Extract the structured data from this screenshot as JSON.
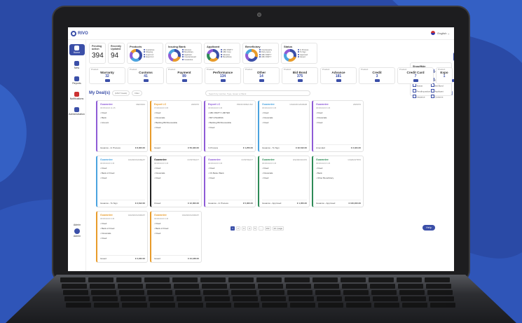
{
  "app": {
    "logo": "RIVO",
    "language": "English"
  },
  "sidebar": {
    "items": [
      {
        "label": "Home",
        "active": true
      },
      {
        "label": "New",
        "active": false
      },
      {
        "label": "Reports",
        "active": false
      },
      {
        "label": "Notifications",
        "active": false
      },
      {
        "label": "Administration",
        "active": false
      }
    ],
    "user_role": "Admin",
    "user_name": "Admin"
  },
  "stats": [
    {
      "label": "Pending action",
      "value": "394"
    },
    {
      "label": "Recently Updated",
      "value": "94"
    }
  ],
  "donuts": [
    {
      "label": "Products",
      "legend": [
        "Guarantee",
        "Shipping",
        "Import LC",
        "Export LC"
      ]
    },
    {
      "label": "Issuing Bank",
      "legend": [
        "Advance",
        "Beneficiary",
        "Applicant",
        "Counterissued",
        "Guarantee"
      ]
    },
    {
      "label": "Applicant",
      "legend": [
        "ABC PARTY",
        "ABC Corp",
        "Advance",
        "Beneficiary"
      ]
    },
    {
      "label": "Beneficiary",
      "legend": [
        "Counterparty",
        "Party name",
        "ABC PARTY",
        "ABC PARTY"
      ]
    },
    {
      "label": "Status",
      "legend": [
        "In Process",
        "To Sign",
        "Approved",
        "Issued"
      ]
    }
  ],
  "show_hide": {
    "title": "Show/Hide",
    "options": [
      "Recently Updated",
      "Products",
      "Issuing Bank",
      "Beneficiary",
      "Status",
      "Bid Bond",
      "Pending action",
      "Applicant",
      "Issuance",
      "Customs"
    ]
  },
  "products": [
    {
      "name": "Warranty",
      "count": "32"
    },
    {
      "name": "Customs",
      "count": "41"
    },
    {
      "name": "Payment",
      "count": "89"
    },
    {
      "name": "Performance",
      "count": "134"
    },
    {
      "name": "Other",
      "count": "14"
    },
    {
      "name": "Bid Bond",
      "count": "375"
    },
    {
      "name": "Advance",
      "count": "181"
    },
    {
      "name": "Credit",
      "count": "3"
    },
    {
      "name": "Credit Card",
      "count": "7"
    },
    {
      "name": "Expo",
      "count": "1"
    }
  ],
  "deals": {
    "title": "My Deal(s)",
    "count_pill": "(1847 Deals)",
    "filter": "Filter",
    "search_placeholder": "Search by number, Type, Issuer or Bank",
    "cards": [
      {
        "type": "Guarantee",
        "ref": "REF0044",
        "date": "06/05/2023 11:45",
        "lines": [
          "Fixed",
          "Bank",
          "Amount"
        ],
        "status": "Issuance - In Process",
        "amount": "€ 8,300.00",
        "color": "#8e5bd6"
      },
      {
        "type": "Export LC",
        "ref": "LB/0070",
        "date": "07/06/2023 6:05",
        "lines": [
          "Fixed",
          "Financials",
          "Backlog Bill Receivable",
          "Fixed"
        ],
        "status": "Issued",
        "amount": "€ 56,333.00",
        "color": "#e89b2a"
      },
      {
        "type": "Export LC",
        "ref": "PROFORMA INV",
        "date": "06/06/2023 6:45",
        "lines": [
          "ABC PARTY LIMITED",
          "BOY-PHARMA",
          "Backlog Bill Receivable",
          "Fixed"
        ],
        "status": "In Process",
        "amount": "€ 1,250.00",
        "color": "#8e5bd6"
      },
      {
        "type": "Guarantee",
        "ref": "GS2023/1234RAB",
        "date": "06/06/2023 6:45",
        "lines": [
          "Fixed",
          "Financials",
          "Fixed"
        ],
        "status": "Issuance - To Sign",
        "amount": "€ 32,542.00",
        "color": "#4aa3df"
      },
      {
        "type": "Guarantee",
        "ref": "LB/0070",
        "date": "06/06/2023 6:45",
        "lines": [
          "Fixed",
          "Financials",
          "Fixed"
        ],
        "status": "Amended",
        "amount": "€ 2,334.00",
        "color": "#8e5bd6"
      },
      {
        "type": "Guarantee",
        "ref": "GS2023/1234EAT",
        "date": "06/06/2023 6:45",
        "lines": [
          "Fixed",
          "Bank of Fixed",
          "Fixed"
        ],
        "status": "Issuance - To Sign",
        "amount": "€ 2,612.00",
        "color": "#4aa3df"
      },
      {
        "type": "Guarantee",
        "ref": "CONTRACT",
        "date": "06/06/2023 6:45",
        "lines": [
          "Fixed",
          "Financials",
          "Fixed"
        ],
        "status": "Closed",
        "amount": "€ 12,000.00",
        "color": "#222222"
      },
      {
        "type": "Guarantee",
        "ref": "CONTRACT",
        "date": "06/06/2023 6:45",
        "lines": [
          "Fixed",
          "CS Better Bank",
          "Fixed"
        ],
        "status": "Issuance - In Process",
        "amount": "€ 5,300.00",
        "color": "#8e5bd6"
      },
      {
        "type": "Guarantee",
        "ref": "GS2023/10470",
        "date": "06/06/2023 6:45",
        "lines": [
          "Fixed",
          "Financials",
          "Fixed"
        ],
        "status": "Issuance - Approved",
        "amount": "€ 1,350.00",
        "color": "#2e8b57"
      },
      {
        "type": "Guarantee",
        "ref": "GS2023/7870",
        "date": "06/06/2023 6:45",
        "lines": [
          "Fixed",
          "Bank",
          "Other Beneficiary"
        ],
        "status": "Issuance - Approved",
        "amount": "€ 100,000.00",
        "color": "#2e8b57"
      },
      {
        "type": "Guarantee",
        "ref": "GS2023/1234RAT",
        "date": "06/06/2023 6:45",
        "lines": [
          "Fixed",
          "Bank of Fixed",
          "Financials",
          "Fixed"
        ],
        "status": "Issued",
        "amount": "€ 2,232.00",
        "color": "#e89b2a"
      },
      {
        "type": "Guarantee",
        "ref": "GS2023/1234RAT",
        "date": "06/06/2023 6:45",
        "lines": [
          "Fixed",
          "Bank of Fixed",
          "Fixed"
        ],
        "status": "Issued",
        "amount": "€ 43,188.00",
        "color": "#e89b2a"
      }
    ]
  },
  "pager": {
    "pages": [
      "1",
      "2",
      "3",
      "4",
      "5",
      "...",
      "102"
    ],
    "current": "1",
    "per_page": "10 / page"
  },
  "help": "Help",
  "colors": {
    "brand": "#3b4fa8",
    "background": "#2a4aa6"
  }
}
